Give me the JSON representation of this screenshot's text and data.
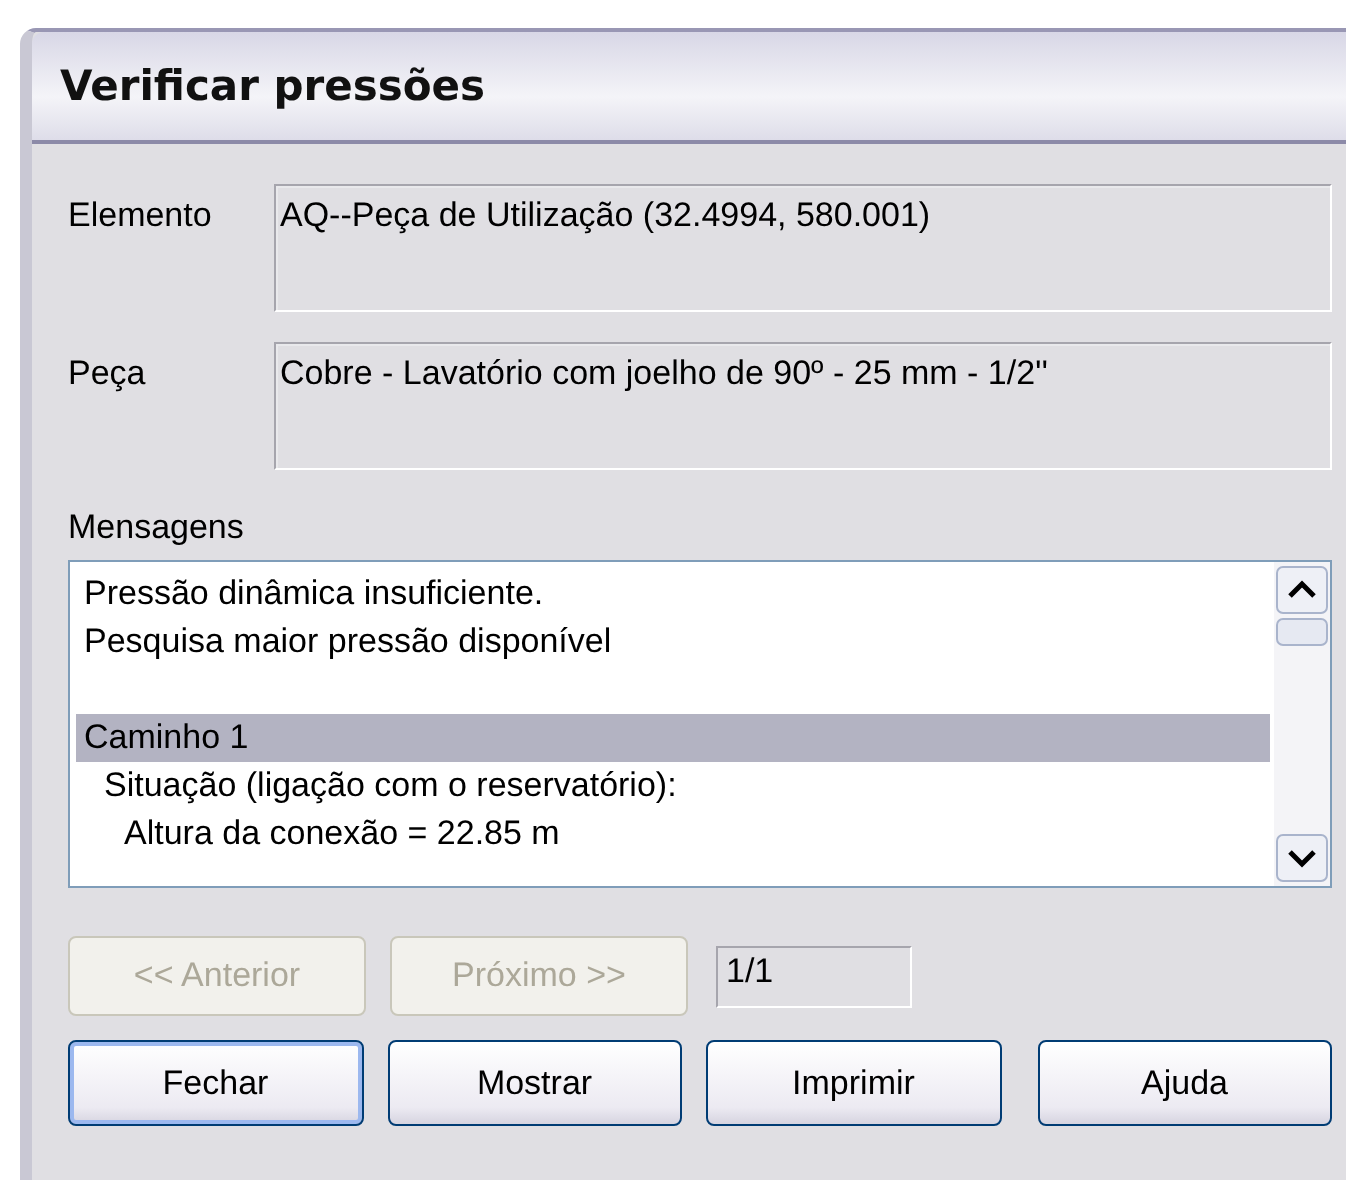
{
  "window": {
    "title": "Verificar pressões"
  },
  "fields": [
    {
      "label": "Elemento",
      "value": "AQ--Peça de Utilização (32.4994, 580.001)"
    },
    {
      "label": "Peça",
      "value": "Cobre - Lavatório com joelho de 90º - 25 mm - 1/2''"
    }
  ],
  "messages": {
    "label": "Mensagens",
    "groups": [
      {
        "items": [
          {
            "text": "Pressão dinâmica insuficiente.",
            "selected": false
          },
          {
            "text": "Pesquisa maior pressão disponível",
            "selected": false
          }
        ]
      },
      {
        "items": [
          {
            "text": "Caminho 1",
            "selected": true,
            "children": [
              {
                "text": "Situação (ligação com o reservatório):",
                "selected": false,
                "children": [
                  {
                    "text": "Altura da conexão = 22.85 m",
                    "selected": false
                  }
                ]
              }
            ]
          }
        ]
      }
    ]
  },
  "navigation": {
    "buttons": [
      {
        "label": "<< Anterior",
        "disabled": true
      },
      {
        "label": "Próximo >>",
        "disabled": true
      }
    ],
    "page": "1/1"
  },
  "buttons": [
    {
      "label": "Fechar",
      "default": true
    },
    {
      "label": "Mostrar",
      "default": false
    },
    {
      "label": "Imprimir",
      "default": false
    },
    {
      "label": "Ajuda",
      "default": false
    }
  ]
}
